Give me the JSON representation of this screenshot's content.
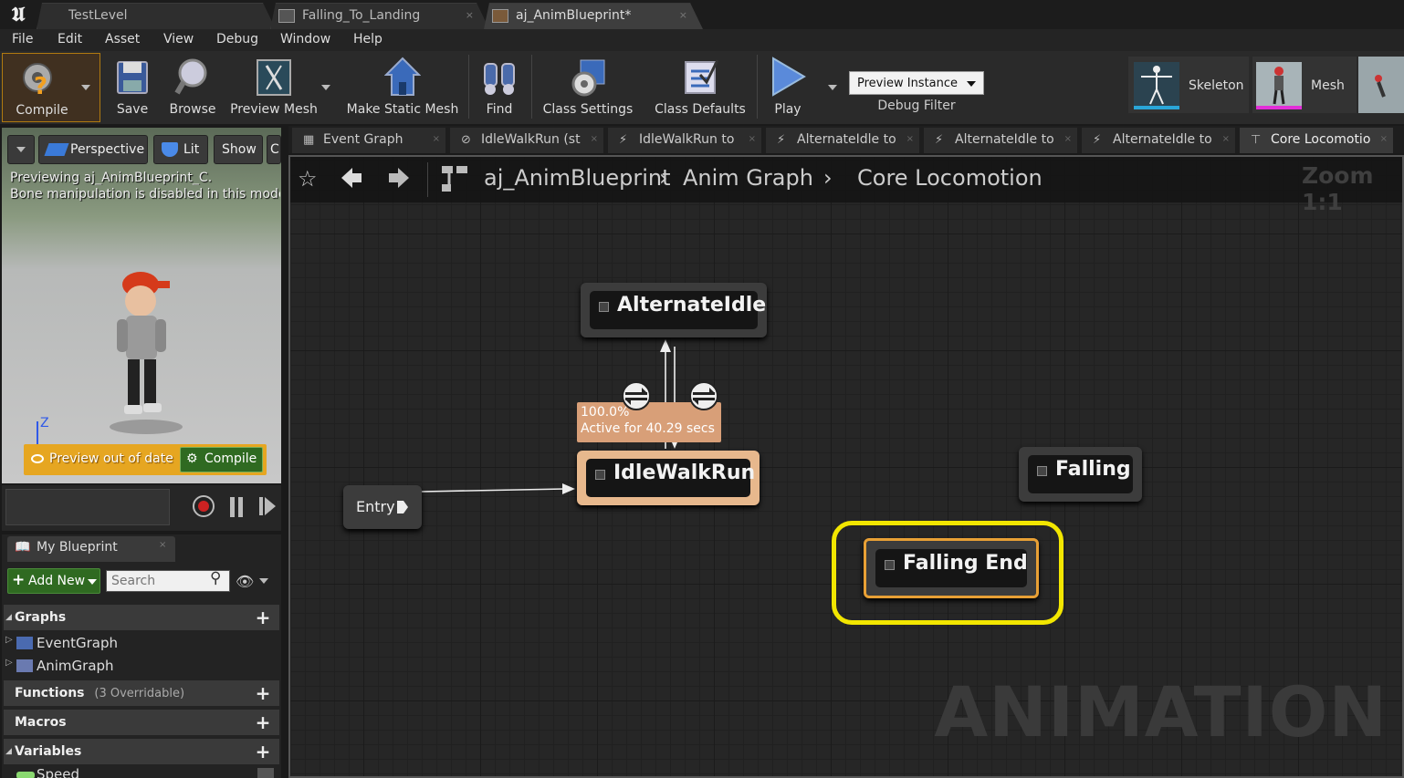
{
  "window": {
    "tabs": [
      {
        "label": "TestLevel"
      },
      {
        "label": "Falling_To_Landing"
      },
      {
        "label": "aj_AnimBlueprint*"
      }
    ]
  },
  "menu": [
    "File",
    "Edit",
    "Asset",
    "View",
    "Debug",
    "Window",
    "Help"
  ],
  "toolbar": {
    "compile": "Compile",
    "save": "Save",
    "browse": "Browse",
    "preview_mesh": "Preview Mesh",
    "make_static_mesh": "Make Static Mesh",
    "find": "Find",
    "class_settings": "Class Settings",
    "class_defaults": "Class Defaults",
    "play": "Play",
    "preview_instance": "Preview Instance",
    "debug_filter": "Debug Filter",
    "skeleton": "Skeleton",
    "mesh": "Mesh"
  },
  "viewport": {
    "perspective": "Perspective",
    "lit": "Lit",
    "show": "Show",
    "show_extra": "C",
    "info_line1": "Previewing aj_AnimBlueprint_C.",
    "info_line2": "Bone manipulation is disabled in this mode.",
    "axis": "Z",
    "preview_out_of_date": "Preview out of date",
    "compile": "Compile"
  },
  "my_blueprint": {
    "tab_label": "My Blueprint",
    "add_new": "Add New",
    "search_placeholder": "Search",
    "graphs_label": "Graphs",
    "graphs": [
      "EventGraph",
      "AnimGraph"
    ],
    "functions_label": "Functions",
    "functions_note": "(3 Overridable)",
    "macros_label": "Macros",
    "variables_label": "Variables",
    "variable_first": "Speed"
  },
  "graph_tabs": [
    "Event Graph",
    "IdleWalkRun (st",
    "IdleWalkRun to",
    "AlternateIdle to",
    "AlternateIdle to",
    "AlternateIdle to",
    "Core Locomotio"
  ],
  "breadcrumb": {
    "root": "aj_AnimBlueprint",
    "graph": "Anim Graph",
    "state_machine": "Core Locomotion",
    "zoom": "Zoom 1:1"
  },
  "nodes": {
    "alternate_idle": "AlternateIdle",
    "idle_walk_run": "IdleWalkRun",
    "falling": "Falling",
    "falling_end": "Falling End",
    "entry": "Entry"
  },
  "debug_tooltip": {
    "weight": "100.0%",
    "active": "Active for 40.29 secs"
  },
  "watermark": "ANIMATION",
  "colors": {
    "active_state": "#e7b88d",
    "highlight": "#f2e600",
    "selected": "#e8a035",
    "warn_bar": "#e6a621",
    "compile_green": "#2f6a21"
  }
}
